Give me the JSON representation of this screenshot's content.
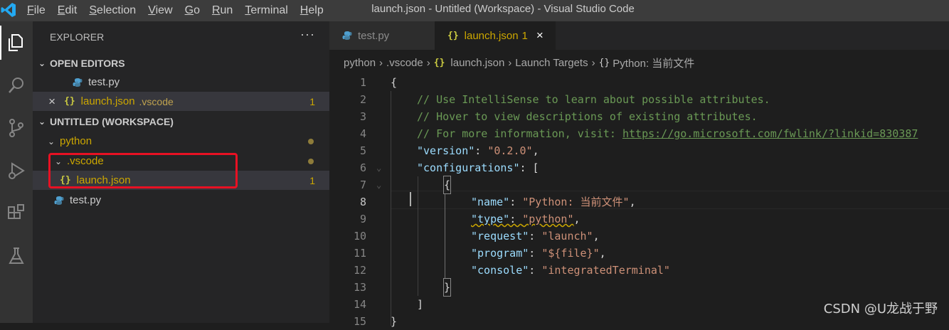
{
  "titlebar": {
    "menu": [
      "File",
      "Edit",
      "Selection",
      "View",
      "Go",
      "Run",
      "Terminal",
      "Help"
    ],
    "window_title": "launch.json - Untitled (Workspace) - Visual Studio Code",
    "logo_icon": "vscode-logo"
  },
  "activitybar": {
    "items": [
      "explorer-icon",
      "search-icon",
      "source-control-icon",
      "run-debug-icon",
      "extensions-icon",
      "testing-icon"
    ]
  },
  "sidebar": {
    "title": "EXPLORER",
    "more": "···",
    "open_editors": {
      "header": "OPEN EDITORS",
      "items": [
        {
          "name": "test.py"
        },
        {
          "name": "launch.json",
          "folder": ".vscode",
          "badge": "1"
        }
      ]
    },
    "workspace": {
      "header": "UNTITLED (WORKSPACE)",
      "tree": {
        "python": "python",
        "vscode": ".vscode",
        "launch": "launch.json",
        "launch_badge": "1",
        "testpy": "test.py"
      }
    }
  },
  "tabs": [
    {
      "label": "test.py"
    },
    {
      "label": "launch.json",
      "badge": "1",
      "close": "×"
    }
  ],
  "breadcrumb": [
    "python",
    ".vscode",
    "launch.json",
    "Launch Targets",
    "Python: 当前文件"
  ],
  "code": {
    "line_numbers": [
      "1",
      "2",
      "3",
      "4",
      "5",
      "6",
      "7",
      "8",
      "9",
      "10",
      "11",
      "12",
      "13",
      "14",
      "15"
    ],
    "l1": "{",
    "l2": "// Use IntelliSense to learn about possible attributes.",
    "l3": "// Hover to view descriptions of existing attributes.",
    "l4_prefix": "// For more information, visit: ",
    "l4_link": "https://go.microsoft.com/fwlink/?linkid=830387",
    "l5_key": "\"version\"",
    "l5_val": "\"0.2.0\"",
    "l6_key": "\"configurations\"",
    "l6_rest": ": [",
    "l7": "{",
    "l8_key": "\"name\"",
    "l8_val": "\"Python: 当前文件\"",
    "l9_key": "\"type\"",
    "l9_val": "\"python\"",
    "l10_key": "\"request\"",
    "l10_val": "\"launch\"",
    "l11_key": "\"program\"",
    "l11_val": "\"${file}\"",
    "l12_key": "\"console\"",
    "l12_val": "\"integratedTerminal\"",
    "l13": "}",
    "l14": "]",
    "l15": "}"
  },
  "watermark": "CSDN @U龙战于野",
  "colors": {
    "accent_red_box": "#e81123",
    "modified_yellow": "#cca700",
    "comment_green": "#6a9955",
    "key_blue": "#9cdcfe",
    "string_orange": "#ce9178"
  }
}
